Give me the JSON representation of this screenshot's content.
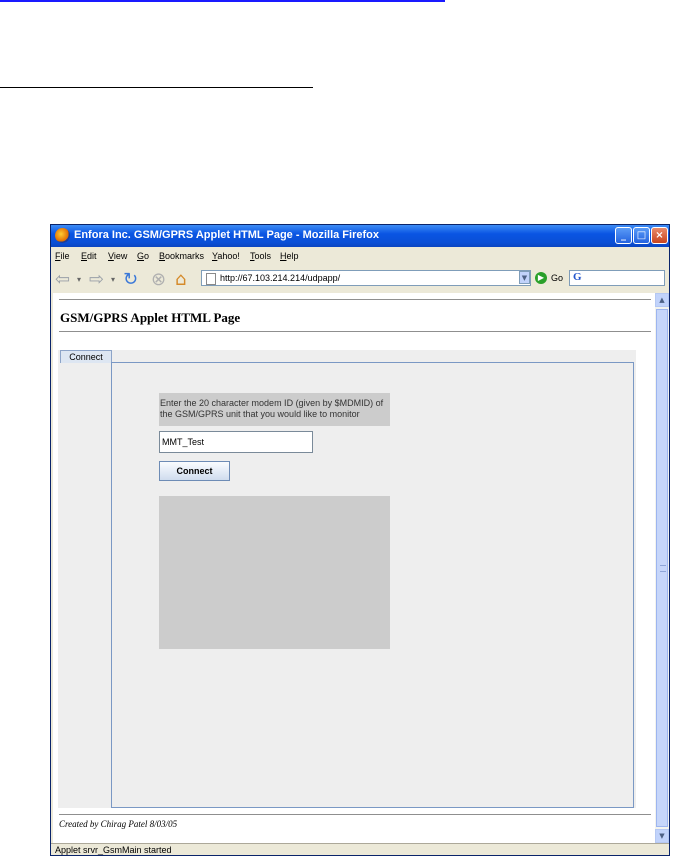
{
  "window": {
    "title": "Enfora Inc. GSM/GPRS Applet HTML Page - Mozilla Firefox",
    "controls": {
      "minimize": "_",
      "maximize": "□",
      "close": "×"
    }
  },
  "menu": [
    "File",
    "Edit",
    "View",
    "Go",
    "Bookmarks",
    "Yahoo!",
    "Tools",
    "Help"
  ],
  "navigation": {
    "url": "http://67.103.214.214/udpapp/",
    "go_label": "Go",
    "icons": [
      "back-icon",
      "forward-icon",
      "reload-icon",
      "stop-icon",
      "home-icon",
      "go-icon",
      "google-search-icon"
    ]
  },
  "page": {
    "heading": "GSM/GPRS Applet HTML Page",
    "tab_label": "Connect",
    "instruction": "Enter the 20 character modem ID (given by $MDMID) of the GSM/GPRS unit that you would like to monitor",
    "modem_id_value": "MMT_Test",
    "connect_button": "Connect",
    "footer": "Created by Chirag Patel 8/03/05"
  },
  "status": "Applet srvr_GsmMain started",
  "colors": {
    "titlebar": "#0a55e3",
    "applet_bg": "#eeeeee",
    "panel_border": "#7a98c4",
    "output_bg": "#cccccc"
  }
}
